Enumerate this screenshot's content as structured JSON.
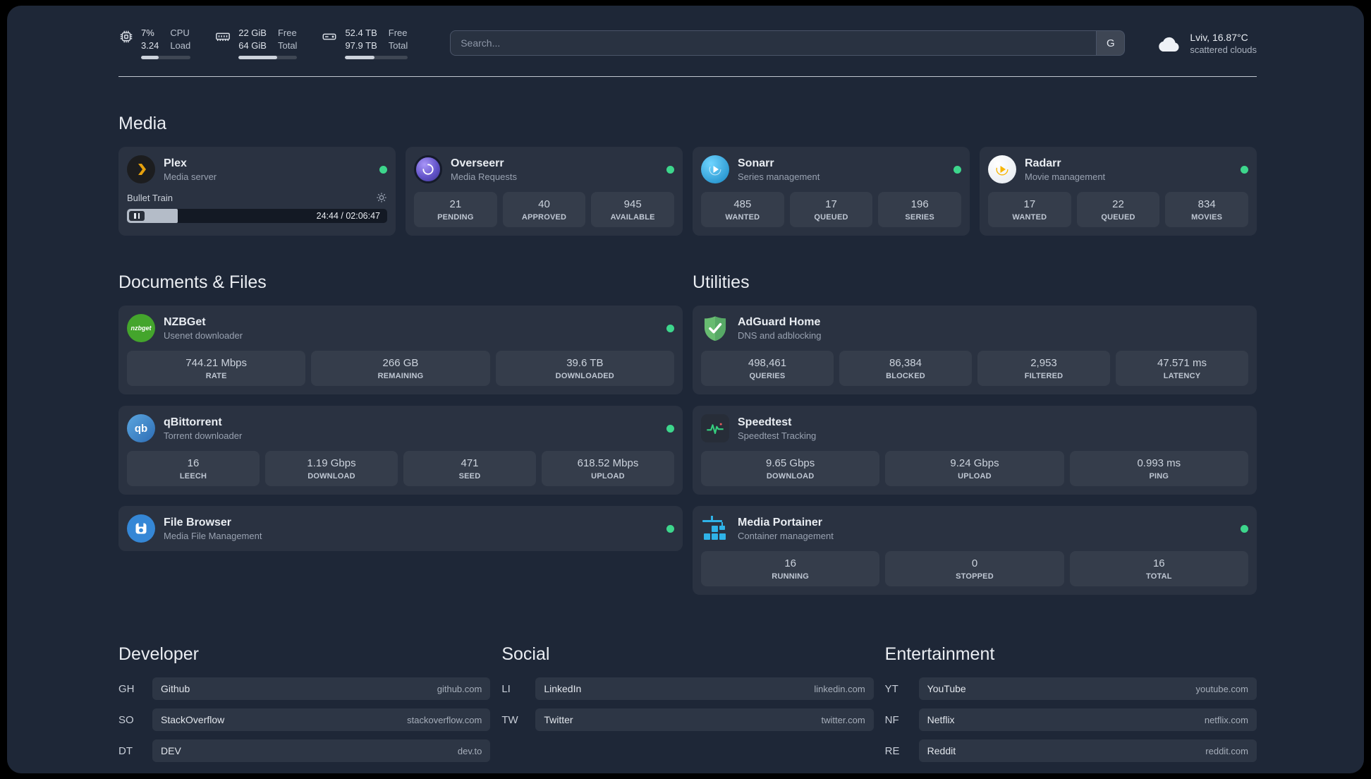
{
  "topbar": {
    "cpu": {
      "icon": "cpu-chip",
      "col1": [
        "7%",
        "3.24"
      ],
      "col2": [
        "CPU",
        "Load"
      ],
      "progress": 35
    },
    "ram": {
      "icon": "ram-stick",
      "col1": [
        "22 GiB",
        "64 GiB"
      ],
      "col2": [
        "Free",
        "Total"
      ],
      "progress": 66
    },
    "disk": {
      "icon": "hard-drive",
      "col1": [
        "52.4 TB",
        "97.9 TB"
      ],
      "col2": [
        "Free",
        "Total"
      ],
      "progress": 47
    },
    "search": {
      "placeholder": "Search...",
      "button_label": "G"
    },
    "weather": {
      "icon": "cloud",
      "location": "Lviv, 16.87°C",
      "condition": "scattered clouds"
    }
  },
  "media": {
    "title": "Media",
    "plex": {
      "name": "Plex",
      "desc": "Media server",
      "status": "online",
      "now_playing": "Bullet Train",
      "time": "24:44 / 02:06:47",
      "progress": 19.5
    },
    "overseerr": {
      "name": "Overseerr",
      "desc": "Media Requests",
      "status": "online",
      "stats": [
        {
          "value": "21",
          "label": "PENDING"
        },
        {
          "value": "40",
          "label": "APPROVED"
        },
        {
          "value": "945",
          "label": "AVAILABLE"
        }
      ]
    },
    "sonarr": {
      "name": "Sonarr",
      "desc": "Series management",
      "status": "online",
      "stats": [
        {
          "value": "485",
          "label": "WANTED"
        },
        {
          "value": "17",
          "label": "QUEUED"
        },
        {
          "value": "196",
          "label": "SERIES"
        }
      ]
    },
    "radarr": {
      "name": "Radarr",
      "desc": "Movie management",
      "status": "online",
      "stats": [
        {
          "value": "17",
          "label": "WANTED"
        },
        {
          "value": "22",
          "label": "QUEUED"
        },
        {
          "value": "834",
          "label": "MOVIES"
        }
      ]
    }
  },
  "documents": {
    "title": "Documents & Files",
    "nzbget": {
      "name": "NZBGet",
      "desc": "Usenet downloader",
      "status": "online",
      "stats": [
        {
          "value": "744.21 Mbps",
          "label": "RATE"
        },
        {
          "value": "266 GB",
          "label": "REMAINING"
        },
        {
          "value": "39.6 TB",
          "label": "DOWNLOADED"
        }
      ]
    },
    "qbittorrent": {
      "name": "qBittorrent",
      "desc": "Torrent downloader",
      "status": "online",
      "stats": [
        {
          "value": "16",
          "label": "LEECH"
        },
        {
          "value": "1.19 Gbps",
          "label": "DOWNLOAD"
        },
        {
          "value": "471",
          "label": "SEED"
        },
        {
          "value": "618.52 Mbps",
          "label": "UPLOAD"
        }
      ]
    },
    "filebrowser": {
      "name": "File Browser",
      "desc": "Media File Management",
      "status": "online"
    }
  },
  "utilities": {
    "title": "Utilities",
    "adguard": {
      "name": "AdGuard Home",
      "desc": "DNS and adblocking",
      "stats": [
        {
          "value": "498,461",
          "label": "QUERIES"
        },
        {
          "value": "86,384",
          "label": "BLOCKED"
        },
        {
          "value": "2,953",
          "label": "FILTERED"
        },
        {
          "value": "47.571 ms",
          "label": "LATENCY"
        }
      ]
    },
    "speedtest": {
      "name": "Speedtest",
      "desc": "Speedtest Tracking",
      "stats": [
        {
          "value": "9.65 Gbps",
          "label": "DOWNLOAD"
        },
        {
          "value": "9.24 Gbps",
          "label": "UPLOAD"
        },
        {
          "value": "0.993 ms",
          "label": "PING"
        }
      ]
    },
    "portainer": {
      "name": "Media Portainer",
      "desc": "Container management",
      "status": "online",
      "stats": [
        {
          "value": "16",
          "label": "RUNNING"
        },
        {
          "value": "0",
          "label": "STOPPED"
        },
        {
          "value": "16",
          "label": "TOTAL"
        }
      ]
    }
  },
  "bookmarks": [
    {
      "title": "Developer",
      "links": [
        {
          "abbr": "GH",
          "name": "Github",
          "url": "github.com"
        },
        {
          "abbr": "SO",
          "name": "StackOverflow",
          "url": "stackoverflow.com"
        },
        {
          "abbr": "DT",
          "name": "DEV",
          "url": "dev.to"
        }
      ]
    },
    {
      "title": "Social",
      "links": [
        {
          "abbr": "LI",
          "name": "LinkedIn",
          "url": "linkedin.com"
        },
        {
          "abbr": "TW",
          "name": "Twitter",
          "url": "twitter.com"
        }
      ]
    },
    {
      "title": "Entertainment",
      "links": [
        {
          "abbr": "YT",
          "name": "YouTube",
          "url": "youtube.com"
        },
        {
          "abbr": "NF",
          "name": "Netflix",
          "url": "netflix.com"
        },
        {
          "abbr": "RE",
          "name": "Reddit",
          "url": "reddit.com"
        }
      ]
    }
  ],
  "colors": {
    "status_online": "#3dd68c",
    "plex_gold": "#e5a00d",
    "background": "#1e2737"
  },
  "icons": {
    "nzbget_label": "nzbget",
    "qbittorrent_label": "qb"
  }
}
